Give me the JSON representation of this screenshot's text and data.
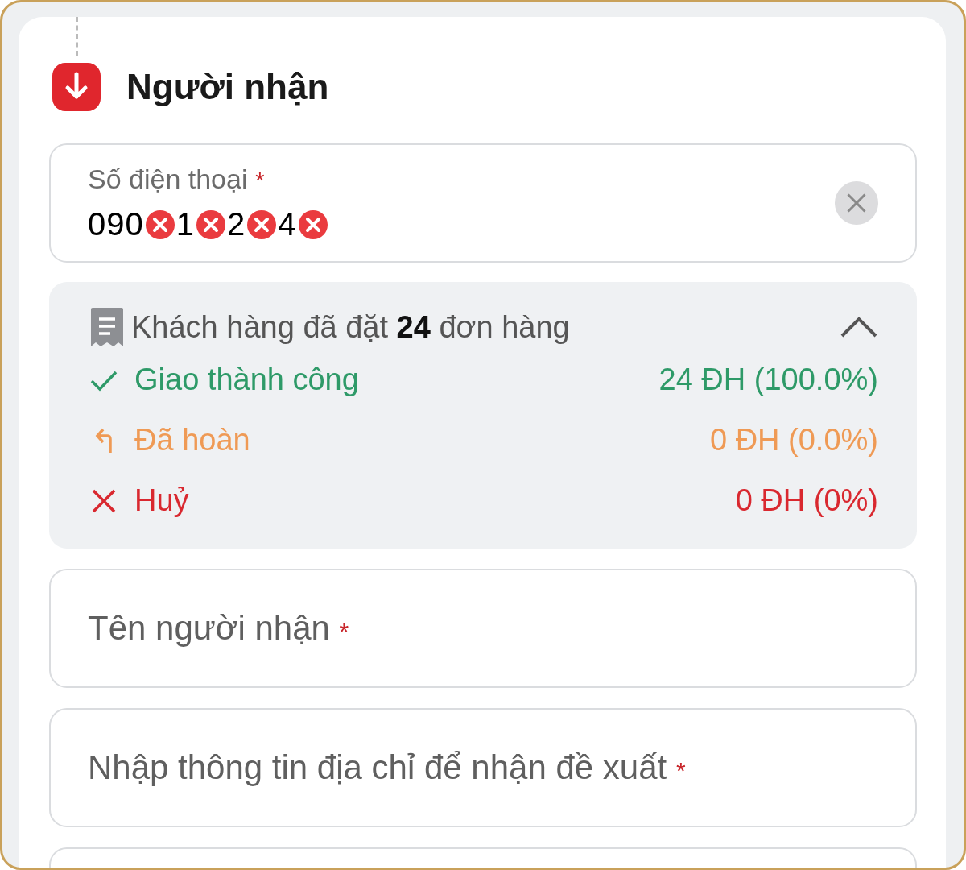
{
  "section": {
    "title": "Người nhận"
  },
  "phone_field": {
    "label": "Số điện thoại",
    "required_mark": "*",
    "value_parts": [
      {
        "text": "090",
        "redacted": true
      },
      {
        "text": "1",
        "redacted": true
      },
      {
        "text": "2",
        "redacted": true
      },
      {
        "text": "4",
        "redacted": true
      }
    ]
  },
  "order_summary": {
    "text_before": "Khách hàng đã đặt",
    "count": "24",
    "text_after": "đơn hàng",
    "expanded": true,
    "rows": [
      {
        "kind": "delivered",
        "label": "Giao thành công",
        "value": "24 ĐH (100.0%)"
      },
      {
        "kind": "returned",
        "label": "Đã hoàn",
        "value": "0 ĐH (0.0%)"
      },
      {
        "kind": "cancelled",
        "label": "Huỷ",
        "value": "0 ĐH (0%)"
      }
    ]
  },
  "fields": [
    {
      "placeholder": "Tên người nhận",
      "required_mark": "*"
    },
    {
      "placeholder": "Nhập thông tin địa chỉ để nhận đề xuất",
      "required_mark": "*"
    }
  ]
}
